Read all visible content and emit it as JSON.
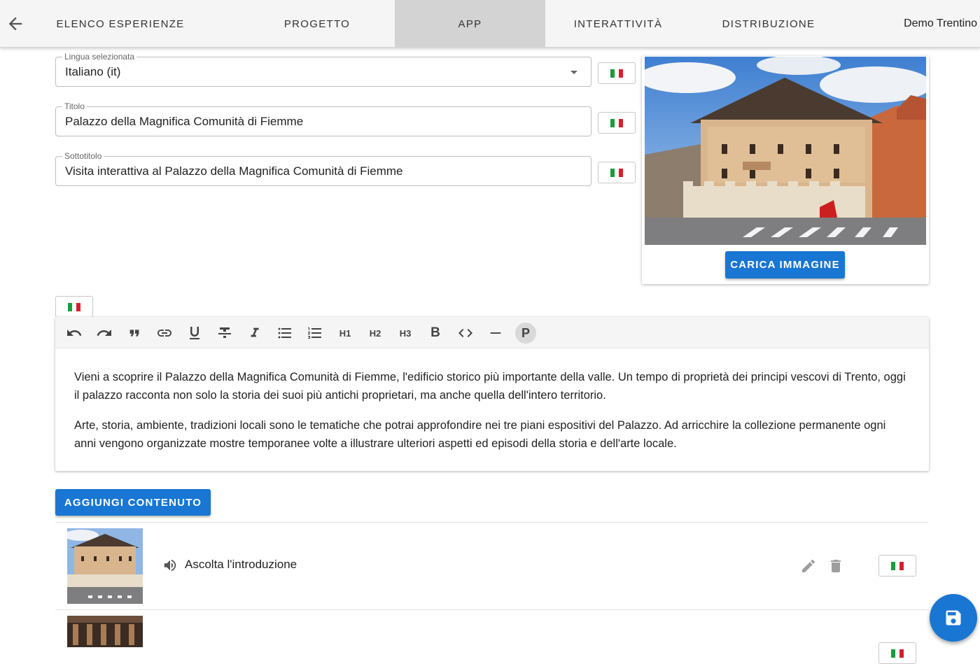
{
  "nav": {
    "tabs": [
      {
        "label": "ELENCO ESPERIENZE"
      },
      {
        "label": "PROGETTO"
      },
      {
        "label": "APP"
      },
      {
        "label": "INTERATTIVITÀ"
      },
      {
        "label": "DISTRIBUZIONE"
      }
    ],
    "active_tab": "APP",
    "user": "Demo Trentino"
  },
  "form": {
    "language": {
      "label": "Lingua selezionata",
      "value": "Italiano (it)"
    },
    "title": {
      "label": "Titolo",
      "value": "Palazzo della Magnifica Comunità di Fiemme"
    },
    "subtitle": {
      "label": "Sottotitolo",
      "value": "Visita interattiva al Palazzo della Magnifica Comunità di Fiemme"
    }
  },
  "image_card": {
    "upload_label": "CARICA IMMAGINE"
  },
  "editor": {
    "toolbar": {
      "h1": "H1",
      "h2": "H2",
      "h3": "H3",
      "bold": "B",
      "paragraph": "P"
    },
    "paragraphs": [
      "Vieni a scoprire il Palazzo della Magnifica Comunità di Fiemme, l'edificio storico più importante della valle. Un tempo di proprietà dei principi vescovi di Trento, oggi il palazzo racconta non solo la storia dei suoi più antichi proprietari, ma anche quella dell'intero territorio.",
      "Arte, storia, ambiente, tradizioni locali sono le tematiche che potrai approfondire nei tre piani espositivi del Palazzo. Ad arricchire la collezione permanente ogni anni vengono organizzate mostre temporanee volte a illustrare ulteriori aspetti ed episodi della storia e dell'arte locale."
    ]
  },
  "add_content_label": "AGGIUNGI CONTENUTO",
  "contents": [
    {
      "title": "Ascolta l'introduzione",
      "type_icon": "volume-icon"
    },
    {
      "title": "",
      "type_icon": ""
    }
  ],
  "colors": {
    "primary": "#1976d2",
    "flag_green": "#1f9a3b",
    "flag_red": "#d4202a"
  }
}
